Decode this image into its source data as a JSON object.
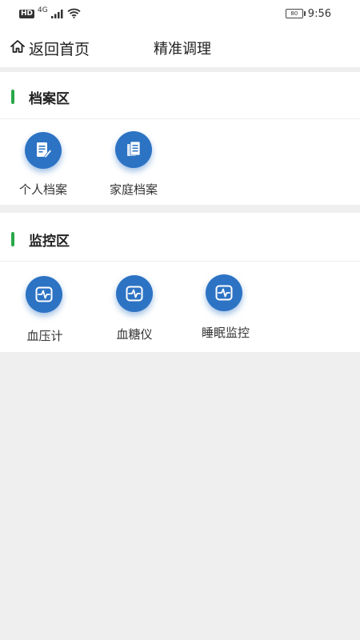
{
  "status_bar": {
    "hd_badge": "HD",
    "network_type": "4G",
    "battery_level": "80",
    "time": "9:56",
    "icons": [
      "signal-icon",
      "wifi-icon",
      "battery-icon"
    ]
  },
  "nav": {
    "back_label": "返回首页",
    "title": "精准调理"
  },
  "sections": [
    {
      "title": "档案区",
      "items": [
        {
          "label": "个人档案",
          "icon": "document-edit-icon"
        },
        {
          "label": "家庭档案",
          "icon": "documents-icon"
        }
      ]
    },
    {
      "title": "监控区",
      "items": [
        {
          "label": "血压计",
          "icon": "heartbeat-monitor-icon"
        },
        {
          "label": "血糖仪",
          "icon": "heartbeat-monitor-icon"
        },
        {
          "label": "睡眠监控",
          "icon": "heartbeat-monitor-icon"
        }
      ]
    }
  ],
  "colors": {
    "accent_green": "#2aa84a",
    "icon_blue": "#2d73c4",
    "background_gray": "#efefef"
  }
}
